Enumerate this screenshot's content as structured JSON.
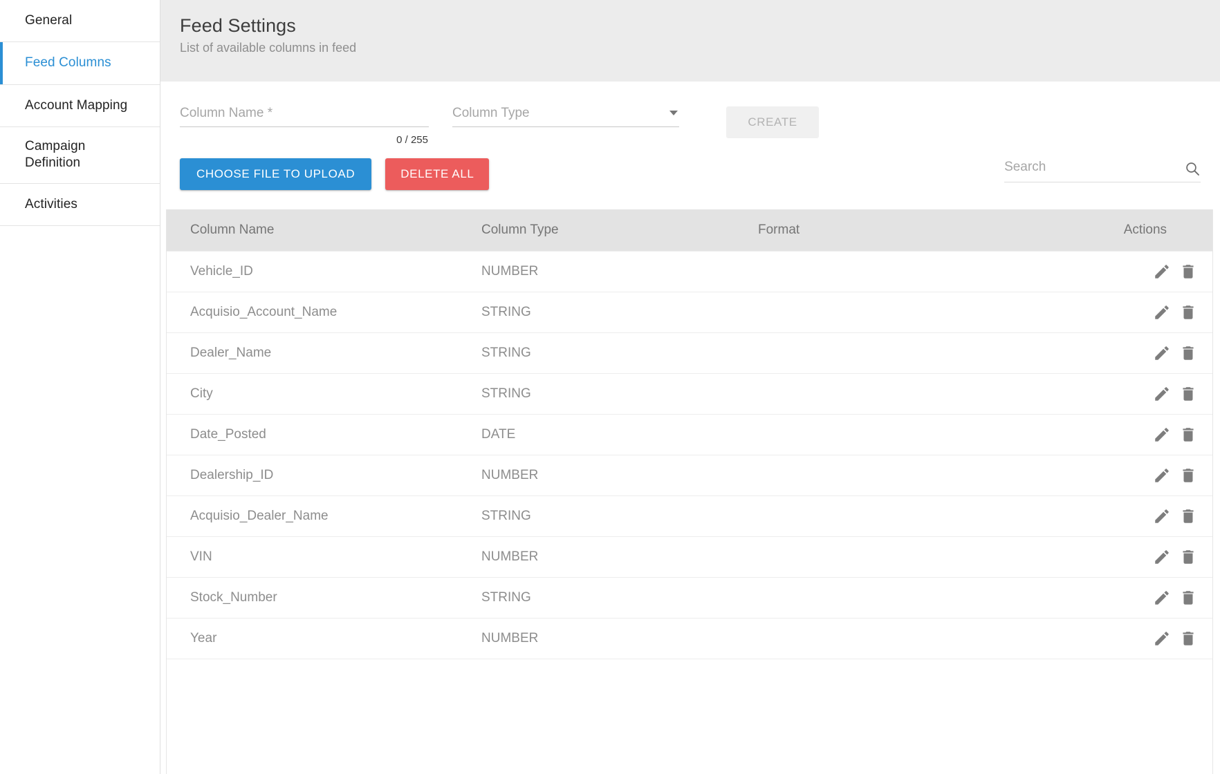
{
  "sidebar": {
    "items": [
      {
        "label": "General",
        "active": false
      },
      {
        "label": "Feed Columns",
        "active": true
      },
      {
        "label": "Account Mapping",
        "active": false
      },
      {
        "label": "Campaign Definition",
        "active": false
      },
      {
        "label": "Activities",
        "active": false
      }
    ]
  },
  "header": {
    "title": "Feed Settings",
    "subtitle": "List of available columns in feed"
  },
  "form": {
    "column_name_placeholder": "Column Name *",
    "column_name_value": "",
    "char_counter": "0 / 255",
    "column_type_placeholder": "Column Type",
    "column_type_value": "",
    "create_label": "CREATE",
    "create_disabled": true
  },
  "actions": {
    "upload_label": "CHOOSE FILE TO UPLOAD",
    "delete_all_label": "DELETE ALL",
    "search_placeholder": "Search",
    "search_value": ""
  },
  "table": {
    "headers": [
      "Column Name",
      "Column Type",
      "Format",
      "Actions"
    ],
    "rows": [
      {
        "name": "Vehicle_ID",
        "type": "NUMBER",
        "format": ""
      },
      {
        "name": "Acquisio_Account_Name",
        "type": "STRING",
        "format": ""
      },
      {
        "name": "Dealer_Name",
        "type": "STRING",
        "format": ""
      },
      {
        "name": "City",
        "type": "STRING",
        "format": ""
      },
      {
        "name": "Date_Posted",
        "type": "DATE",
        "format": ""
      },
      {
        "name": "Dealership_ID",
        "type": "NUMBER",
        "format": ""
      },
      {
        "name": "Acquisio_Dealer_Name",
        "type": "STRING",
        "format": ""
      },
      {
        "name": "VIN",
        "type": "NUMBER",
        "format": ""
      },
      {
        "name": "Stock_Number",
        "type": "STRING",
        "format": ""
      },
      {
        "name": "Year",
        "type": "NUMBER",
        "format": ""
      }
    ],
    "row_actions": [
      "edit-icon",
      "delete-icon"
    ]
  },
  "colors": {
    "accent_blue": "#2b8fd4",
    "danger_red": "#ec5c5c",
    "header_band": "#ececec",
    "table_header": "#e3e3e3",
    "text_muted": "#8d8d8d"
  }
}
